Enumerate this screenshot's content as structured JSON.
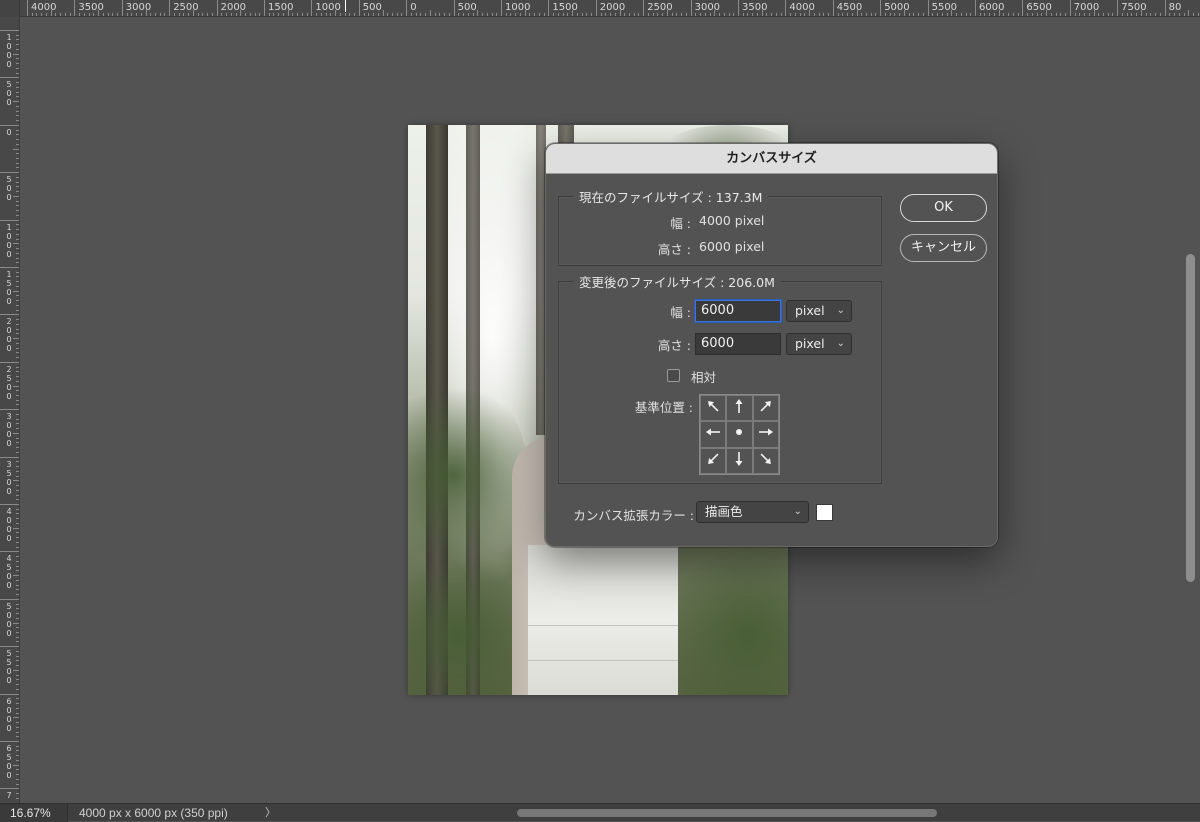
{
  "ruler": {
    "top_labels": [
      "4000",
      "3500",
      "3000",
      "2500",
      "2000",
      "1500",
      "1000",
      "500",
      "0",
      "500",
      "1000",
      "1500",
      "2000",
      "2500",
      "3000",
      "3500",
      "4000",
      "4500",
      "5000",
      "5500",
      "6000",
      "6500",
      "7000",
      "7500",
      "80"
    ],
    "left_labels": [
      "1000",
      "500",
      "0",
      "500",
      "1000",
      "1500",
      "2000",
      "2500",
      "3000",
      "3500",
      "4000",
      "4500",
      "5000",
      "5500",
      "6000",
      "6500",
      "7"
    ]
  },
  "dialog": {
    "title": "カンバスサイズ",
    "current": {
      "legend": "現在のファイルサイズ : 137.3M",
      "width_label": "幅 :",
      "width_value": "4000 pixel",
      "height_label": "高さ :",
      "height_value": "6000 pixel"
    },
    "new": {
      "legend": "変更後のファイルサイズ : 206.0M",
      "width_label": "幅 :",
      "width_value": "6000",
      "width_unit": "pixel",
      "height_label": "高さ :",
      "height_value": "6000",
      "height_unit": "pixel",
      "relative_label": "相対",
      "relative_checked": false,
      "anchor_label": "基準位置 :",
      "anchor_icons": [
        "arrow-up-left-icon",
        "arrow-up-icon",
        "arrow-up-right-icon",
        "arrow-left-icon",
        "center-dot-icon",
        "arrow-right-icon",
        "arrow-down-left-icon",
        "arrow-down-icon",
        "arrow-down-right-icon"
      ]
    },
    "extension_color_label": "カンバス拡張カラー :",
    "extension_color_value": "描画色",
    "extension_color_swatch": "#ffffff",
    "ok_label": "OK",
    "cancel_label": "キャンセル"
  },
  "status": {
    "zoom": "16.67%",
    "doc_info": "4000 px x 6000 px (350 ppi)",
    "chevron": "〉"
  }
}
